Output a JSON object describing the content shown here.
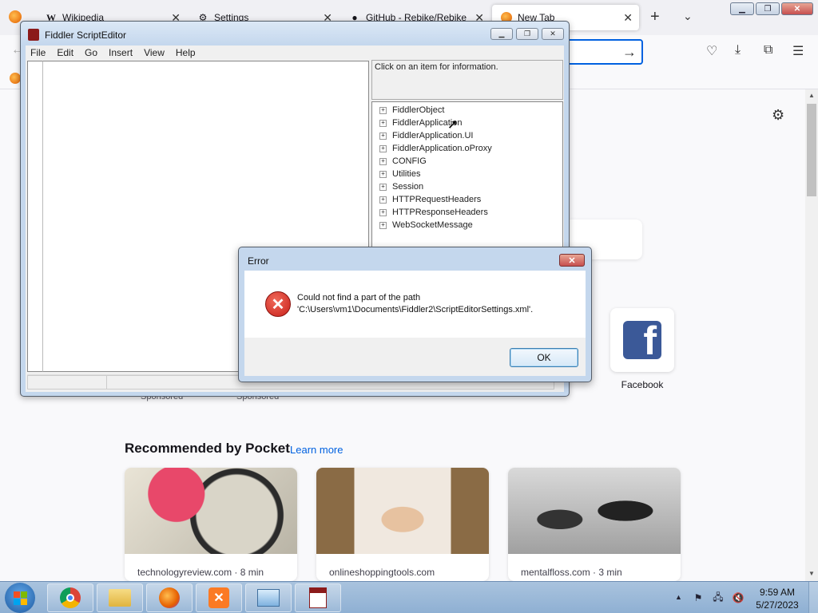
{
  "browser": {
    "tabs": [
      {
        "label": "Wikipedia",
        "icon": "wikipedia-icon",
        "active": false
      },
      {
        "label": "Settings",
        "icon": "gear-icon",
        "active": false
      },
      {
        "label": "GitHub - Rebike/Rebike",
        "icon": "github-icon",
        "active": false
      },
      {
        "label": "New Tab",
        "icon": "firefox-icon",
        "active": true
      }
    ],
    "tab_close": "✕",
    "new_tab": "+",
    "tab_list": "⌄",
    "window_controls": {
      "minimize": "▁",
      "maximize": "❐",
      "close": "✕"
    },
    "url_go": "→"
  },
  "newtab": {
    "shortcut_label": "Facebook",
    "sponsored_label": "Sponsored",
    "pocket_title": "Recommended by Pocket",
    "pocket_learn_more": "Learn more",
    "pocket_cards": [
      {
        "source": "technologyreview.com · 8 min"
      },
      {
        "source": "onlineshoppingtools.com"
      },
      {
        "source": "mentalfloss.com · 3 min"
      }
    ]
  },
  "fiddler": {
    "title": "Fiddler ScriptEditor",
    "menu": [
      "File",
      "Edit",
      "Go",
      "Insert",
      "View",
      "Help"
    ],
    "info_text": "Click on an item for information.",
    "tree_items": [
      "FiddlerObject",
      "FiddlerApplication",
      "FiddlerApplication.UI",
      "FiddlerApplication.oProxy",
      "CONFIG",
      "Utilities",
      "Session",
      "HTTPRequestHeaders",
      "HTTPResponseHeaders",
      "WebSocketMessage"
    ],
    "expander": "+"
  },
  "error_dialog": {
    "title": "Error",
    "message_line1": "Could not find a part of the path",
    "message_line2": "'C:\\Users\\vm1\\Documents\\Fiddler2\\ScriptEditorSettings.xml'.",
    "ok_label": "OK",
    "close_glyph": "✕",
    "icon_glyph": "✕"
  },
  "taskbar": {
    "time": "9:59 AM",
    "date": "5/27/2023",
    "tray_arrow": "▲"
  },
  "colors": {
    "accent": "#0061e0",
    "error_red": "#c8201a",
    "facebook_blue": "#3b5998"
  }
}
